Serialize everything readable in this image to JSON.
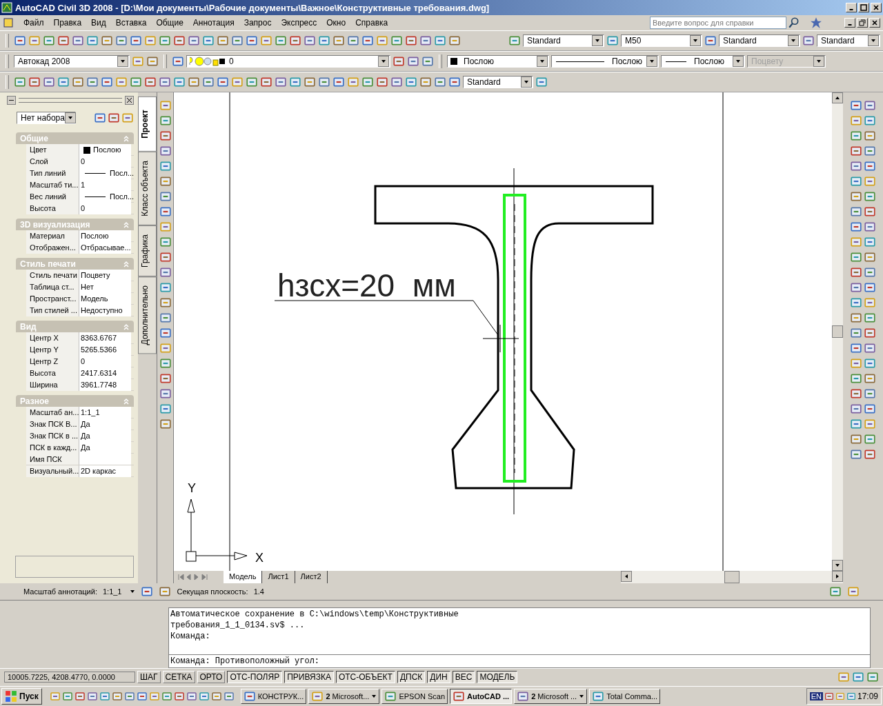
{
  "window": {
    "title": "AutoCAD Civil 3D 2008 - [D:\\Мои документы\\Рабочие документы\\Важное\\Конструктивные требования.dwg]"
  },
  "menu": [
    "Файл",
    "Правка",
    "Вид",
    "Вставка",
    "Общие",
    "Аннотация",
    "Запрос",
    "Экспресс",
    "Окно",
    "Справка"
  ],
  "help_search": {
    "placeholder": "Введите вопрос для справки"
  },
  "toolbars": {
    "text_style": "Standard",
    "dim_style": "M50",
    "table_style": "Standard",
    "multileader_style": "Standard",
    "workspace": "Автокад 2008",
    "layer": "0",
    "color_setting": "Послою",
    "linetype": "Послою",
    "lineweight": "Послою",
    "plot_style": {
      "value": "Поцвету",
      "disabled": true
    },
    "row3_style": "Standard"
  },
  "palette": {
    "selection": "Нет набора",
    "tabs": [
      {
        "label": "Проект",
        "selected": true
      },
      {
        "label": "Класс объекта",
        "selected": false
      },
      {
        "label": "Графика",
        "selected": false
      },
      {
        "label": "Дополнительно",
        "selected": false
      }
    ],
    "sections": [
      {
        "title": "Общие",
        "expanded": true,
        "rows": [
          {
            "name": "Цвет",
            "value": "Послою",
            "kind": "color"
          },
          {
            "name": "Слой",
            "value": "0",
            "kind": "text"
          },
          {
            "name": "Тип линий",
            "value": "Посл...",
            "kind": "line"
          },
          {
            "name": "Масштаб ти...",
            "value": "1",
            "kind": "text"
          },
          {
            "name": "Вес линий",
            "value": "Посл...",
            "kind": "line"
          },
          {
            "name": "Высота",
            "value": "0",
            "kind": "text"
          }
        ]
      },
      {
        "title": "3D визуализация",
        "expanded": true,
        "rows": [
          {
            "name": "Материал",
            "value": "Послою",
            "kind": "text"
          },
          {
            "name": "Отображен...",
            "value": "Отбрасывае...",
            "kind": "text"
          }
        ]
      },
      {
        "title": "Стиль печати",
        "expanded": true,
        "rows": [
          {
            "name": "Стиль печати",
            "value": "Поцвету",
            "kind": "text"
          },
          {
            "name": "Таблица ст...",
            "value": "Нет",
            "kind": "text"
          },
          {
            "name": "Пространст...",
            "value": "Модель",
            "kind": "text"
          },
          {
            "name": "Тип стилей ...",
            "value": "Недоступно",
            "kind": "text"
          }
        ]
      },
      {
        "title": "Вид",
        "expanded": true,
        "rows": [
          {
            "name": "Центр X",
            "value": "8363.6767",
            "kind": "text"
          },
          {
            "name": "Центр Y",
            "value": "5265.5366",
            "kind": "text"
          },
          {
            "name": "Центр Z",
            "value": "0",
            "kind": "text"
          },
          {
            "name": "Высота",
            "value": "2417.6314",
            "kind": "text"
          },
          {
            "name": "Ширина",
            "value": "3961.7748",
            "kind": "text"
          }
        ]
      },
      {
        "title": "Разное",
        "expanded": true,
        "rows": [
          {
            "name": "Масштаб ан...",
            "value": "1:1_1",
            "kind": "text"
          },
          {
            "name": "Знак ПСК В...",
            "value": "Да",
            "kind": "text"
          },
          {
            "name": "Знак ПСК в ...",
            "value": "Да",
            "kind": "text"
          },
          {
            "name": "ПСК в кажд...",
            "value": "Да",
            "kind": "text"
          },
          {
            "name": "Имя ПСК",
            "value": "",
            "kind": "text"
          },
          {
            "name": "Визуальный...",
            "value": "2D каркас",
            "kind": "text"
          }
        ]
      }
    ]
  },
  "drawing": {
    "annotation": "hзсх=20  мм",
    "axis_y": "Y",
    "axis_x": "X"
  },
  "layout_tabs": [
    {
      "label": "Модель",
      "selected": true
    },
    {
      "label": "Лист1",
      "selected": false
    },
    {
      "label": "Лист2",
      "selected": false
    }
  ],
  "annotation_bar": {
    "scale_label": "Масштаб аннотаций:",
    "scale": "1:1_1",
    "plane_label": "Секущая плоскость:",
    "plane": "1.4"
  },
  "command": {
    "history": [
      "Автоматическое сохранение в C:\\windows\\temp\\Конструктивные",
      "требования_1_1_0134.sv$ ...",
      "Команда:"
    ],
    "input": "Команда: Противоположный угол:"
  },
  "status_bar": {
    "coordinates": "10005.7225, 4208.4770, 0.0000",
    "toggles": [
      {
        "label": "ШАГ",
        "on": false
      },
      {
        "label": "СЕТКА",
        "on": false
      },
      {
        "label": "ОРТО",
        "on": false
      },
      {
        "label": "ОТС-ПОЛЯР",
        "on": true
      },
      {
        "label": "ПРИВЯЗКА",
        "on": true
      },
      {
        "label": "ОТС-ОБЪЕКТ",
        "on": true
      },
      {
        "label": "ДПСК",
        "on": true
      },
      {
        "label": "ДИН",
        "on": true
      },
      {
        "label": "ВЕС",
        "on": true
      },
      {
        "label": "МОДЕЛЬ",
        "on": true
      }
    ]
  },
  "taskbar": {
    "start": "Пуск",
    "tasks": [
      {
        "label": "КОНСТРУК...",
        "selected": false,
        "grouped": false
      },
      {
        "label": "**2** Microsoft...",
        "selected": false,
        "grouped": true
      },
      {
        "label": "EPSON Scan",
        "selected": false,
        "grouped": false
      },
      {
        "label": "AutoCAD ...",
        "selected": true,
        "grouped": false
      },
      {
        "label": "**2** Microsoft ...",
        "selected": false,
        "grouped": true
      },
      {
        "label": "Total Comma...",
        "selected": false,
        "grouped": false
      }
    ],
    "language": "EN",
    "clock": "17:09"
  }
}
